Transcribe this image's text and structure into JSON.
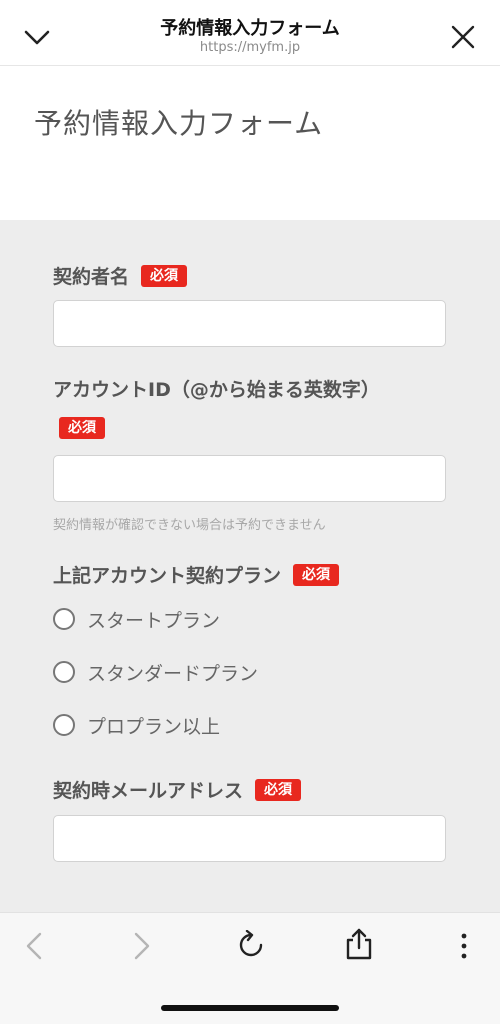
{
  "topbar": {
    "title": "予約情報入力フォーム",
    "url": "https://myfm.jp"
  },
  "page": {
    "title": "予約情報入力フォーム"
  },
  "required_label": "必須",
  "fields": {
    "contractor_name": {
      "label": "契約者名",
      "value": ""
    },
    "account_id": {
      "label": "アカウントID（@から始まる英数字）",
      "value": "",
      "hint": "契約情報が確認できない場合は予約できません"
    },
    "plan": {
      "label": "上記アカウント契約プラン",
      "options": [
        "スタートプラン",
        "スタンダードプラン",
        "プロプラン以上"
      ]
    },
    "email": {
      "label": "契約時メールアドレス",
      "value": ""
    }
  },
  "bottombar": {
    "icons": [
      "back-icon",
      "forward-icon",
      "reload-icon",
      "share-icon",
      "more-icon"
    ]
  }
}
